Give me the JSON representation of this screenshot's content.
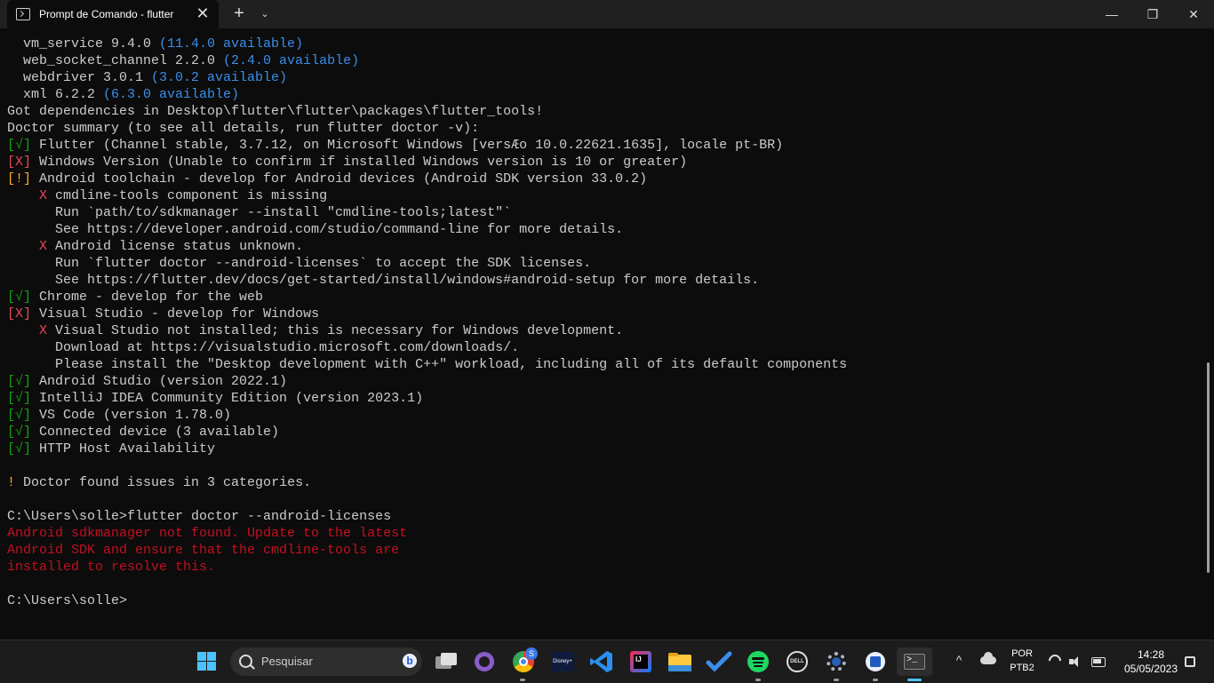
{
  "window": {
    "tab_title": "Prompt de Comando - flutter",
    "close_tab_glyph": "✕",
    "new_tab_glyph": "+",
    "dropdown_glyph": "⌄",
    "minimize_glyph": "—",
    "maximize_glyph": "❐",
    "close_glyph": "✕"
  },
  "terminal": {
    "lines": [
      {
        "segs": [
          {
            "t": "  vm_service 9.4.0 ",
            "c": ""
          },
          {
            "t": "(11.4.0 available)",
            "c": "c-blue"
          }
        ]
      },
      {
        "segs": [
          {
            "t": "  web_socket_channel 2.2.0 ",
            "c": ""
          },
          {
            "t": "(2.4.0 available)",
            "c": "c-blue"
          }
        ]
      },
      {
        "segs": [
          {
            "t": "  webdriver 3.0.1 ",
            "c": ""
          },
          {
            "t": "(3.0.2 available)",
            "c": "c-blue"
          }
        ]
      },
      {
        "segs": [
          {
            "t": "  xml 6.2.2 ",
            "c": ""
          },
          {
            "t": "(6.3.0 available)",
            "c": "c-blue"
          }
        ]
      },
      {
        "segs": [
          {
            "t": "Got dependencies in Desktop\\flutter\\flutter\\packages\\flutter_tools!",
            "c": ""
          }
        ]
      },
      {
        "segs": [
          {
            "t": "Doctor summary (to see all details, run flutter doctor -v):",
            "c": ""
          }
        ]
      },
      {
        "segs": [
          {
            "t": "[√]",
            "c": "c-green"
          },
          {
            "t": " Flutter (Channel stable, 3.7.12, on Microsoft Windows [versÆo 10.0.22621.1635], locale pt-BR)",
            "c": ""
          }
        ]
      },
      {
        "segs": [
          {
            "t": "[X]",
            "c": "c-red"
          },
          {
            "t": " Windows Version (Unable to confirm if installed Windows version is 10 or greater)",
            "c": ""
          }
        ]
      },
      {
        "segs": [
          {
            "t": "[!]",
            "c": "c-yellow"
          },
          {
            "t": " Android toolchain - develop for Android devices (Android SDK version 33.0.2)",
            "c": ""
          }
        ]
      },
      {
        "segs": [
          {
            "t": "    ",
            "c": ""
          },
          {
            "t": "X",
            "c": "c-red"
          },
          {
            "t": " cmdline-tools component is missing",
            "c": ""
          }
        ]
      },
      {
        "segs": [
          {
            "t": "      Run `path/to/sdkmanager --install \"cmdline-tools;latest\"`",
            "c": ""
          }
        ]
      },
      {
        "segs": [
          {
            "t": "      See https://developer.android.com/studio/command-line for more details.",
            "c": ""
          }
        ]
      },
      {
        "segs": [
          {
            "t": "    ",
            "c": ""
          },
          {
            "t": "X",
            "c": "c-red"
          },
          {
            "t": " Android license status unknown.",
            "c": ""
          }
        ]
      },
      {
        "segs": [
          {
            "t": "      Run `flutter doctor --android-licenses` to accept the SDK licenses.",
            "c": ""
          }
        ]
      },
      {
        "segs": [
          {
            "t": "      See https://flutter.dev/docs/get-started/install/windows#android-setup for more details.",
            "c": ""
          }
        ]
      },
      {
        "segs": [
          {
            "t": "[√]",
            "c": "c-green"
          },
          {
            "t": " Chrome - develop for the web",
            "c": ""
          }
        ]
      },
      {
        "segs": [
          {
            "t": "[X]",
            "c": "c-red"
          },
          {
            "t": " Visual Studio - develop for Windows",
            "c": ""
          }
        ]
      },
      {
        "segs": [
          {
            "t": "    ",
            "c": ""
          },
          {
            "t": "X",
            "c": "c-red"
          },
          {
            "t": " Visual Studio not installed; this is necessary for Windows development.",
            "c": ""
          }
        ]
      },
      {
        "segs": [
          {
            "t": "      Download at https://visualstudio.microsoft.com/downloads/.",
            "c": ""
          }
        ]
      },
      {
        "segs": [
          {
            "t": "      Please install the \"Desktop development with C++\" workload, including all of its default components",
            "c": ""
          }
        ]
      },
      {
        "segs": [
          {
            "t": "[√]",
            "c": "c-green"
          },
          {
            "t": " Android Studio (version 2022.1)",
            "c": ""
          }
        ]
      },
      {
        "segs": [
          {
            "t": "[√]",
            "c": "c-green"
          },
          {
            "t": " IntelliJ IDEA Community Edition (version 2023.1)",
            "c": ""
          }
        ]
      },
      {
        "segs": [
          {
            "t": "[√]",
            "c": "c-green"
          },
          {
            "t": " VS Code (version 1.78.0)",
            "c": ""
          }
        ]
      },
      {
        "segs": [
          {
            "t": "[√]",
            "c": "c-green"
          },
          {
            "t": " Connected device (3 available)",
            "c": ""
          }
        ]
      },
      {
        "segs": [
          {
            "t": "[√]",
            "c": "c-green"
          },
          {
            "t": " HTTP Host Availability",
            "c": ""
          }
        ]
      },
      {
        "segs": [
          {
            "t": "",
            "c": ""
          }
        ]
      },
      {
        "segs": [
          {
            "t": "!",
            "c": "c-yellow"
          },
          {
            "t": " Doctor found issues in 3 categories.",
            "c": ""
          }
        ]
      },
      {
        "segs": [
          {
            "t": "",
            "c": ""
          }
        ]
      },
      {
        "segs": [
          {
            "t": "C:\\Users\\solle>flutter doctor --android-licenses",
            "c": ""
          }
        ]
      },
      {
        "segs": [
          {
            "t": "Android sdkmanager not found. Update to the latest",
            "c": "c-redtxt"
          }
        ]
      },
      {
        "segs": [
          {
            "t": "Android SDK and ensure that the cmdline-tools are",
            "c": "c-redtxt"
          }
        ]
      },
      {
        "segs": [
          {
            "t": "installed to resolve this.",
            "c": "c-redtxt"
          }
        ]
      },
      {
        "segs": [
          {
            "t": "",
            "c": ""
          }
        ]
      },
      {
        "segs": [
          {
            "t": "C:\\Users\\solle>",
            "c": ""
          }
        ]
      }
    ]
  },
  "taskbar": {
    "search_placeholder": "Pesquisar",
    "bing_glyph": "b",
    "chrome_badge": "S",
    "disney_label": "Disney+",
    "intellij_label": "IJ",
    "dell_label": "DELL",
    "tray_chevron": "^",
    "language_line1": "POR",
    "language_line2": "PTB2",
    "time": "14:28",
    "date": "05/05/2023"
  }
}
